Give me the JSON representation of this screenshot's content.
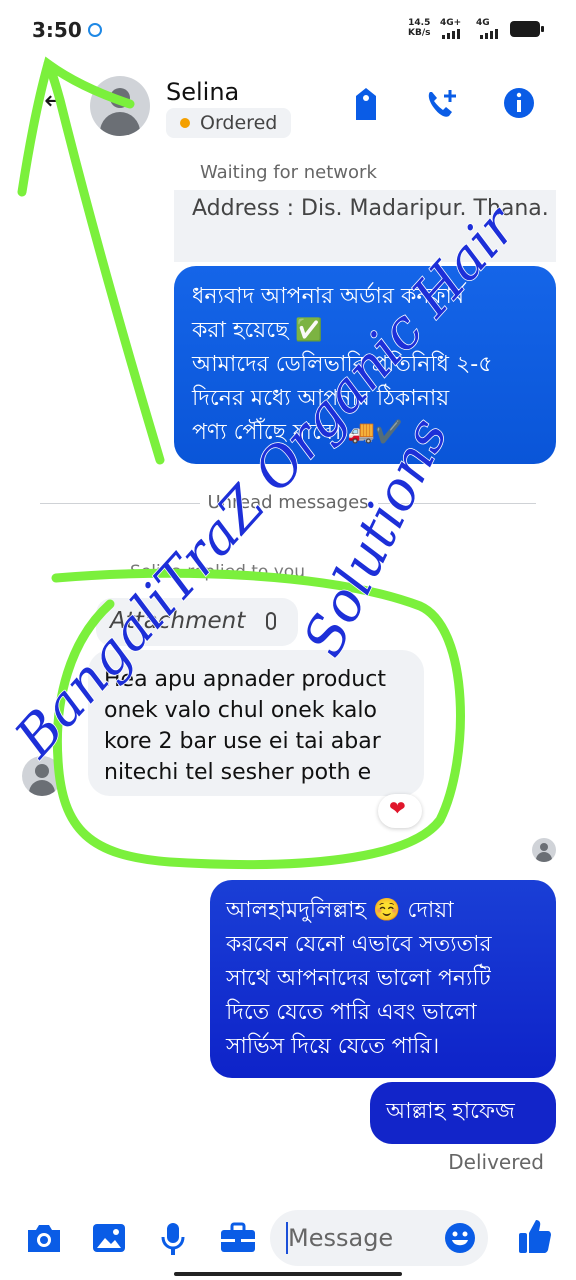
{
  "status_bar": {
    "time": "3:50",
    "net_speed_value": "14.5",
    "net_speed_unit": "KB/s",
    "network_1": "4G+",
    "network_2": "4G"
  },
  "header": {
    "contact_name": "Selina",
    "order_status": "Ordered",
    "icons": [
      "back-arrow-icon",
      "tag-icon",
      "add-call-icon",
      "info-icon"
    ]
  },
  "chat": {
    "network_status": "Waiting for network",
    "address_preview": "Address : Dis. Madaripur. Thana. Rajour. Village lund…",
    "outgoing_1": [
      "ধন্যবাদ আপনার অর্ডার কনফার্ম",
      "করা হয়েছে ✅",
      "আমাদের ডেলিভারি প্রতিনিধি ২-৫",
      "দিনের মধ্যে আপনার ঠিকানায়",
      "পণ্য পৌঁছে যাবে। 🚚✔️"
    ],
    "unread_label": "Unread messages",
    "replied_label": "Selina replied to you",
    "attachment_label": "Attachment",
    "incoming_1": [
      "Hea apu apnader product",
      "onek valo chul onek kalo",
      "kore 2 bar use ei tai abar",
      "nitechi tel sesher poth e"
    ],
    "reaction": "❤️",
    "outgoing_2": [
      "আলহামদুলিল্লাহ ☺️ দোয়া",
      "করবেন যেনো  এভাবে সত্যতার",
      "সাথে আপনাদের ভালো পন্যটি",
      "দিতে যেতে পারি এবং ভালো",
      "সার্ভিস দিয়ে যেতে পারি।"
    ],
    "outgoing_3": "আল্লাহ হাফেজ",
    "delivery_status": "Delivered"
  },
  "composer": {
    "placeholder": "Message",
    "icons": [
      "camera-icon",
      "gallery-icon",
      "microphone-icon",
      "toolbox-icon",
      "emoji-icon",
      "thumbs-up-icon"
    ]
  },
  "watermark": {
    "line_1": "BangaliTraZ Organic Hair",
    "line_2": "Solutions",
    "color": "#1d2fd8"
  },
  "annotation": {
    "color": "#7bf03c"
  },
  "colors": {
    "messenger_blue": "#0a55d8",
    "dark_blue": "#1225c9",
    "incoming_bg": "#f0f2f5",
    "order_dot": "#f4a000"
  }
}
